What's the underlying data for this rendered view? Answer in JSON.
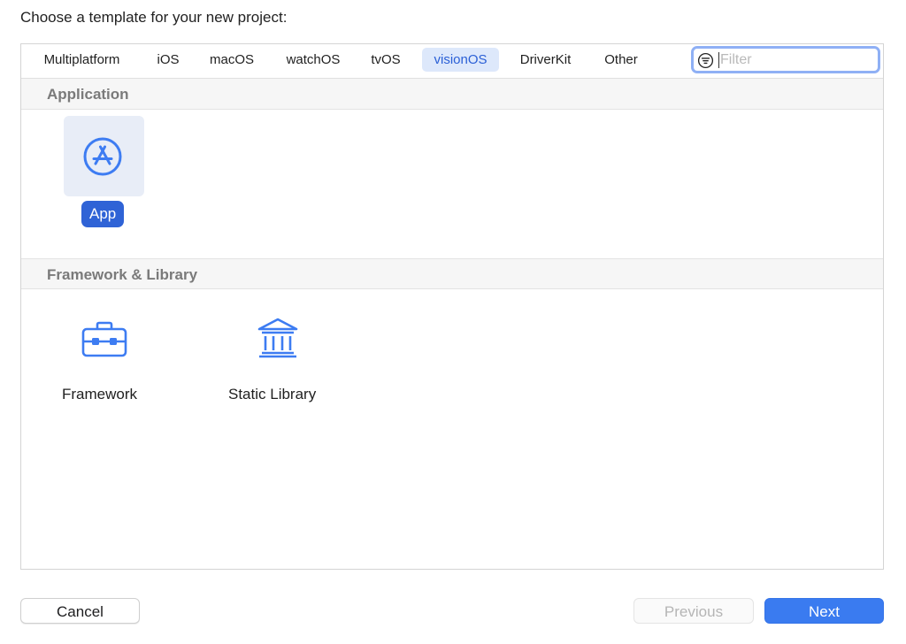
{
  "heading": "Choose a template for your new project:",
  "tabs": [
    {
      "label": "Multiplatform",
      "active": false
    },
    {
      "label": "iOS",
      "active": false
    },
    {
      "label": "macOS",
      "active": false
    },
    {
      "label": "watchOS",
      "active": false
    },
    {
      "label": "tvOS",
      "active": false
    },
    {
      "label": "visionOS",
      "active": true
    },
    {
      "label": "DriverKit",
      "active": false
    },
    {
      "label": "Other",
      "active": false
    }
  ],
  "filter": {
    "placeholder": "Filter",
    "value": "",
    "icon": "filter-icon"
  },
  "sections": [
    {
      "title": "Application",
      "items": [
        {
          "label": "App",
          "icon": "app-store-icon",
          "selected": true
        }
      ]
    },
    {
      "title": "Framework & Library",
      "items": [
        {
          "label": "Framework",
          "icon": "toolbox-icon",
          "selected": false
        },
        {
          "label": "Static Library",
          "icon": "library-building-icon",
          "selected": false
        }
      ]
    }
  ],
  "buttons": {
    "cancel": "Cancel",
    "previous": "Previous",
    "next": "Next"
  },
  "colors": {
    "accent": "#2f63d6",
    "icon_blue": "#3d7cf2",
    "next_button": "#3a7bf0",
    "selected_tab_bg": "#dde8fb"
  }
}
